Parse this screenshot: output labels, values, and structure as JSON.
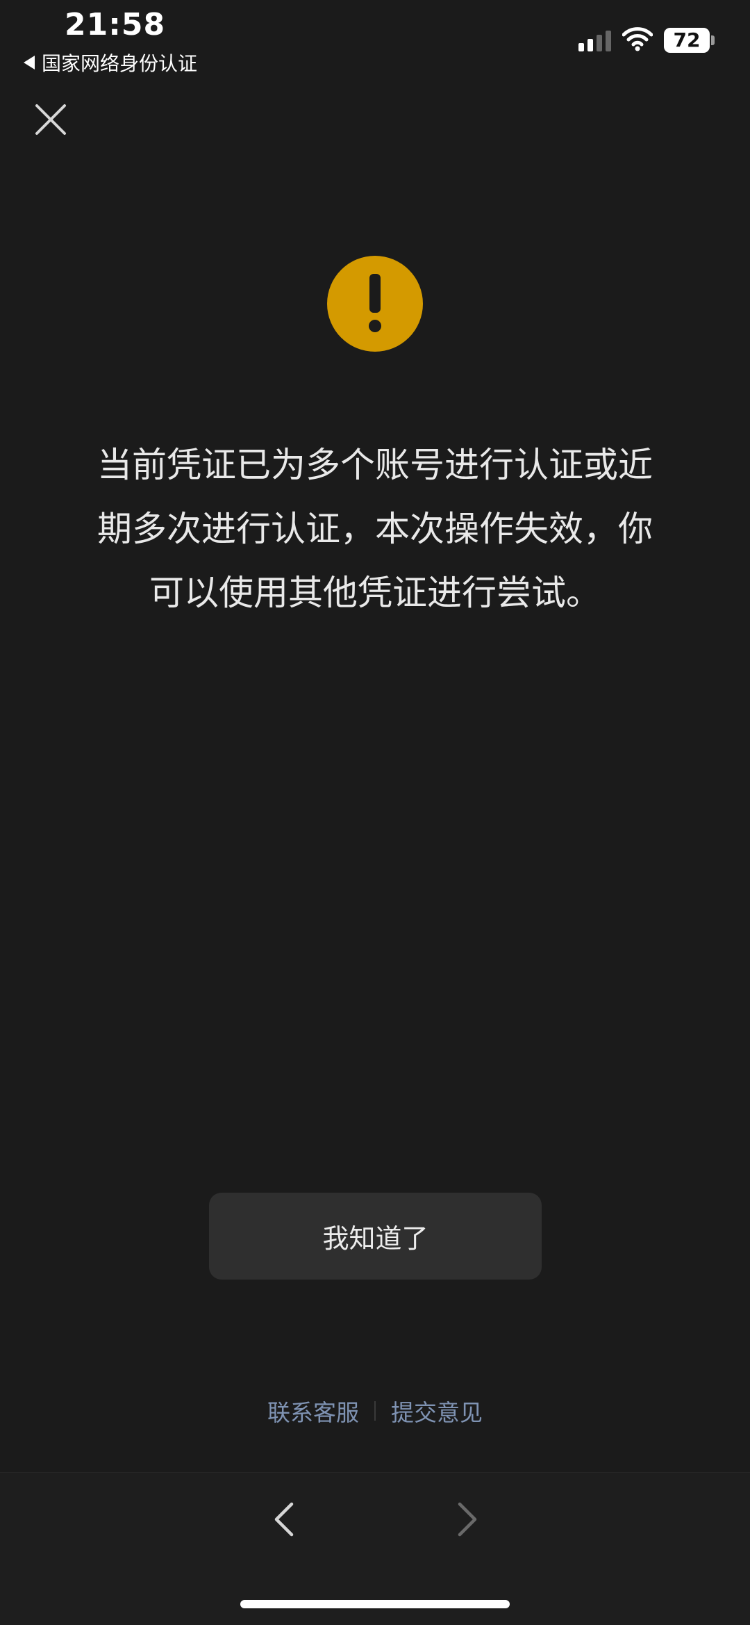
{
  "status_bar": {
    "time": "21:58",
    "back_app_label": "国家网络身份认证",
    "battery_level": "72",
    "signal_bars_filled": 2,
    "signal_bars_total": 4
  },
  "icons": {
    "close": "close-icon",
    "warning": "warning-icon",
    "back": "chevron-left-icon",
    "forward": "chevron-right-icon"
  },
  "colors": {
    "background": "#1b1b1b",
    "warning": "#d49a00",
    "link": "#7f93b3",
    "button_bg": "#2f2f2f"
  },
  "dialog": {
    "message_lines": [
      "当前凭证已为多个账号进行认证或近",
      "期多次进行认证，本次操作失效，你",
      "可以使用其他凭证进行尝试。"
    ],
    "confirm_label": "我知道了"
  },
  "footer": {
    "contact_label": "联系客服",
    "feedback_label": "提交意见"
  },
  "toolbar": {
    "back_enabled": true,
    "forward_enabled": false
  }
}
